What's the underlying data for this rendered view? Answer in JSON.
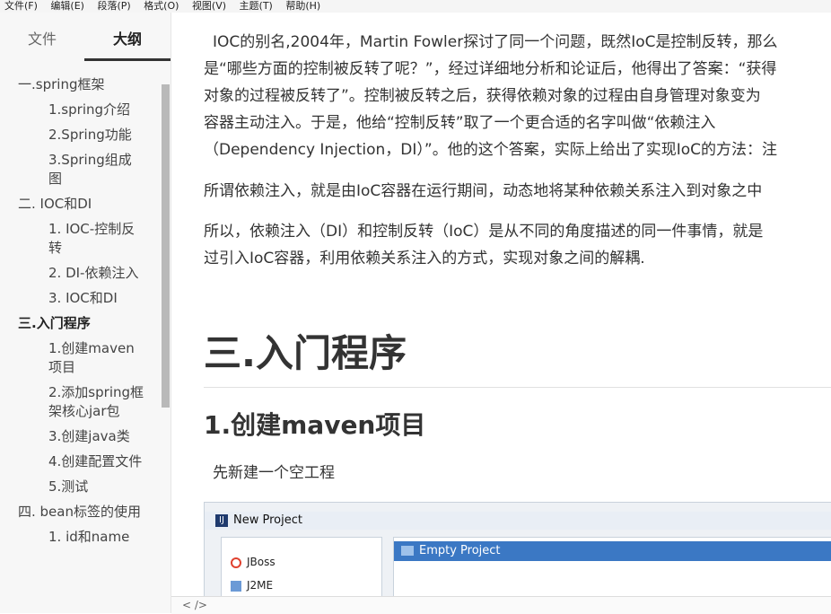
{
  "menubar": {
    "items": [
      "文件(F)",
      "编辑(E)",
      "段落(P)",
      "格式(O)",
      "视图(V)",
      "主题(T)",
      "帮助(H)"
    ]
  },
  "sidebar": {
    "tabs": {
      "files": "文件",
      "outline": "大纲"
    },
    "outline": [
      {
        "level": 1,
        "label": "一.spring框架",
        "active": false
      },
      {
        "level": 2,
        "label": "1.spring介绍",
        "active": false
      },
      {
        "level": 2,
        "label": "2.Spring功能",
        "active": false
      },
      {
        "level": 2,
        "label": "3.Spring组成图",
        "active": false
      },
      {
        "level": 1,
        "label": "二. IOC和DI",
        "active": false
      },
      {
        "level": 2,
        "label": "1. IOC-控制反转",
        "active": false
      },
      {
        "level": 2,
        "label": "2. DI-依赖注入",
        "active": false
      },
      {
        "level": 2,
        "label": "3. IOC和DI",
        "active": false
      },
      {
        "level": 1,
        "label": "三.入门程序",
        "active": true
      },
      {
        "level": 2,
        "label": "1.创建maven项目",
        "active": false
      },
      {
        "level": 2,
        "label": "2.添加spring框架核心jar包",
        "active": false
      },
      {
        "level": 2,
        "label": "3.创建java类",
        "active": false
      },
      {
        "level": 2,
        "label": "4.创建配置文件",
        "active": false
      },
      {
        "level": 2,
        "label": "5.测试",
        "active": false
      },
      {
        "level": 1,
        "label": "四. bean标签的使用",
        "active": false
      },
      {
        "level": 2,
        "label": "1. id和name",
        "active": false
      }
    ]
  },
  "content": {
    "para1": [
      "IOC的别名,2004年，Martin Fowler探讨了同一个问题，既然IoC是控制反转，那么",
      "是“哪些方面的控制被反转了呢？”，经过详细地分析和论证后，他得出了答案：“获得",
      "对象的过程被反转了”。控制被反转之后，获得依赖对象的过程由自身管理对象变为",
      "容器主动注入。于是，他给“控制反转”取了一个更合适的名字叫做“依赖注入",
      "（Dependency Injection，DI）”。他的这个答案，实际上给出了实现IoC的方法：注"
    ],
    "para2": "所谓依赖注入，就是由IoC容器在运行期间，动态地将某种依赖关系注入到对象之中",
    "para3": [
      "所以，依赖注入（DI）和控制反转（IoC）是从不同的角度描述的同一件事情，就是",
      "过引入IoC容器，利用依赖关系注入的方式，实现对象之间的解耦."
    ],
    "h1": "三.入门程序",
    "h2": "1.创建maven项目",
    "ptext": "先新建一个空工程",
    "screenshot": {
      "title": "New Project",
      "left_items": [
        "JBoss",
        "J2ME"
      ],
      "selected_item": "Empty Project"
    }
  },
  "footer": {
    "text": "<  /> "
  },
  "colors": {
    "selection": "#3b78c4",
    "sidebar_bg": "#f7f7f7"
  }
}
